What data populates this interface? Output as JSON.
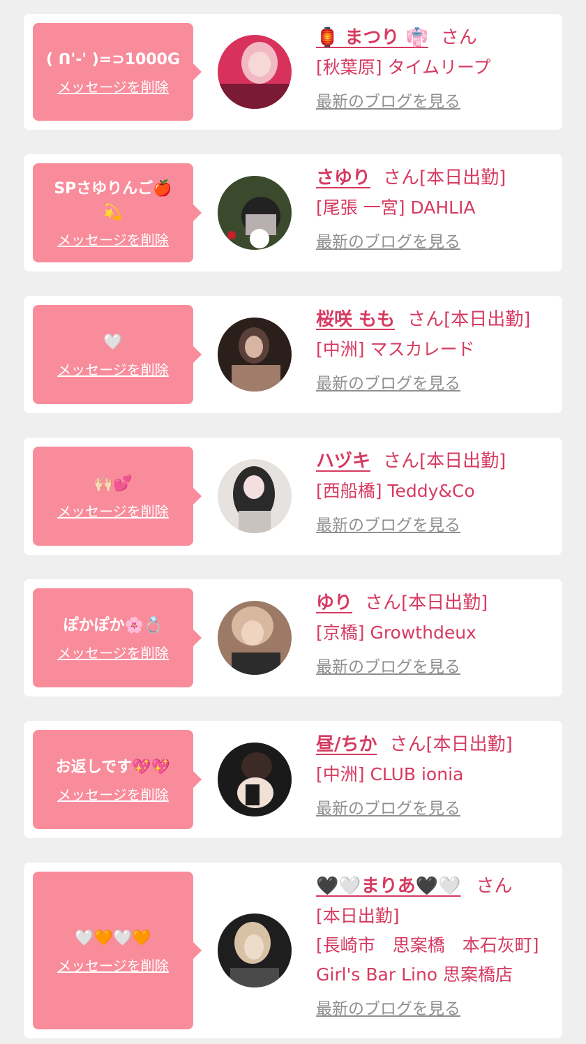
{
  "messages": [
    {
      "message": "( ᑎ'-' )=⊃1000G",
      "delete_label": "メッセージを削除",
      "name": "🏮 まつり 👘",
      "honorific": "さん",
      "status": "",
      "shop": "[秋葉原] タイムリープ",
      "blog_link": "最新のブログを見る",
      "avatar_colors": [
        "#d8325c",
        "#f2b9c4",
        "#7a1a34"
      ]
    },
    {
      "message": "SPさゆりんご🍎💫",
      "delete_label": "メッセージを削除",
      "name": "さゆり",
      "honorific": "さん",
      "status": "[本日出勤]",
      "shop": "[尾張 一宮] DAHLIA",
      "blog_link": "最新のブログを見る",
      "avatar_colors": [
        "#3b4a2d",
        "#b8b0b0",
        "#222222"
      ]
    },
    {
      "message": "🤍",
      "delete_label": "メッセージを削除",
      "name": "桜咲 もも",
      "honorific": "さん",
      "status": "[本日出勤]",
      "shop": "[中洲] マスカレード",
      "blog_link": "最新のブログを見る",
      "avatar_colors": [
        "#2b1f1c",
        "#a07c6a",
        "#5a4038"
      ]
    },
    {
      "message": "🙌🏻💕",
      "delete_label": "メッセージを削除",
      "name": "ハヅキ",
      "honorific": "さん",
      "status": "[本日出勤]",
      "shop": "[西船橋] Teddy&Co",
      "blog_link": "最新のブログを見る",
      "avatar_colors": [
        "#e6e2e0",
        "#2a2a2a",
        "#c9c3c0"
      ]
    },
    {
      "message": "ぽかぽか🌸💍",
      "delete_label": "メッセージを削除",
      "name": "ゆり",
      "honorific": "さん",
      "status": "[本日出勤]",
      "shop": "[京橋] Growthdeux",
      "blog_link": "最新のブログを見る",
      "avatar_colors": [
        "#d9b8a0",
        "#2c2c2c",
        "#9c7a66"
      ]
    },
    {
      "message": "お返しです💖💖",
      "delete_label": "メッセージを削除",
      "name": "昼/ちか",
      "honorific": "さん",
      "status": "[本日出勤]",
      "shop": "[中洲] CLUB ionia",
      "blog_link": "最新のブログを見る",
      "avatar_colors": [
        "#1a1a1a",
        "#f0e0d6",
        "#3c2a26"
      ]
    },
    {
      "message": "🤍🧡🤍🧡",
      "delete_label": "メッセージを削除",
      "name": "🖤🤍まりあ🖤🤍",
      "honorific": "さん",
      "status": "[本日出勤]",
      "shop": "[長崎市　思案橋　本石灰町] Girl's Bar Lino 思案橋店",
      "blog_link": "最新のブログを見る",
      "avatar_colors": [
        "#4a4a4a",
        "#d8c2a6",
        "#1e1e1e"
      ]
    }
  ]
}
